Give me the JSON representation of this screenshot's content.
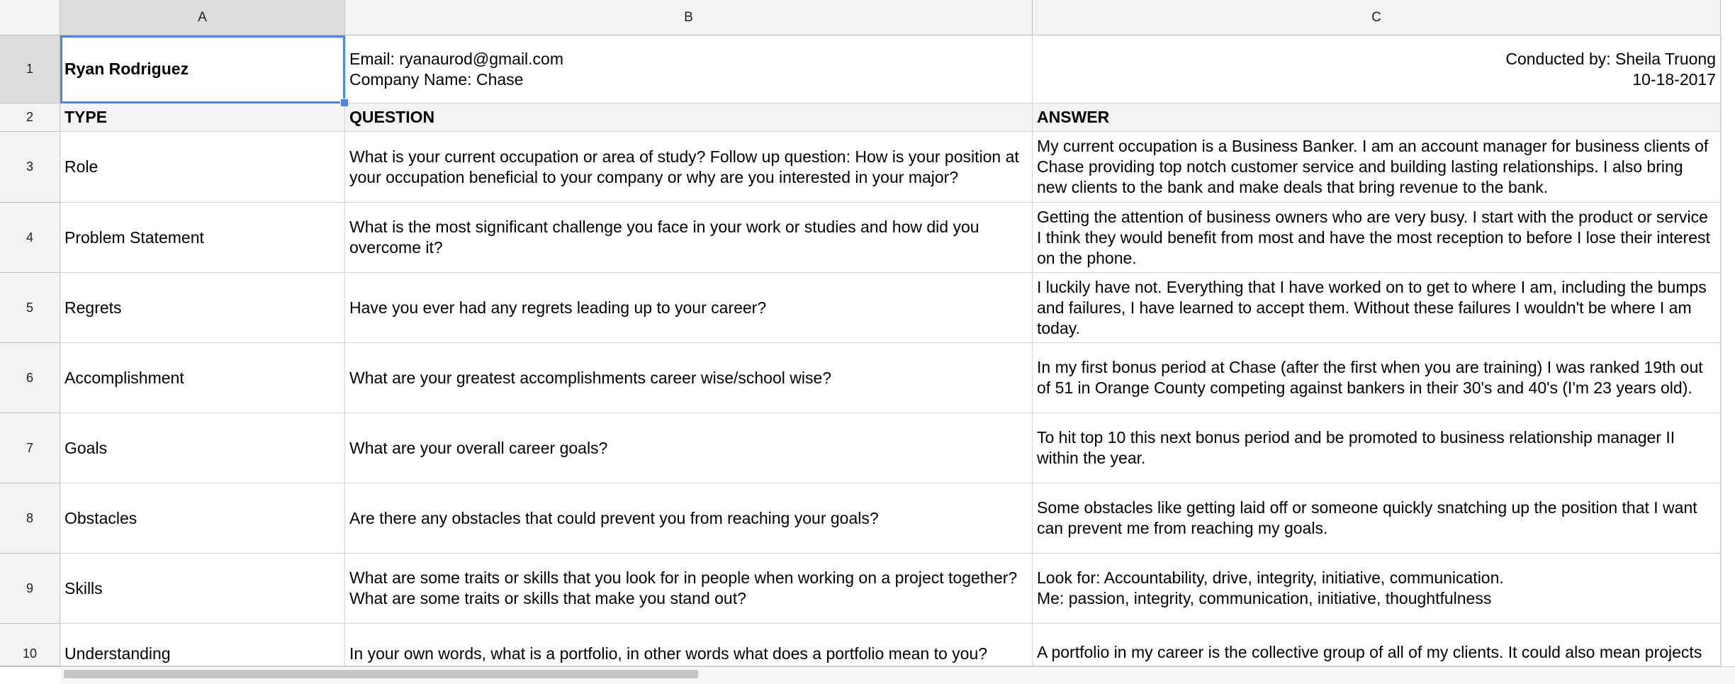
{
  "columns": [
    "A",
    "B",
    "C"
  ],
  "rows": [
    "1",
    "2",
    "3",
    "4",
    "5",
    "6",
    "7",
    "8",
    "9",
    "10"
  ],
  "header": {
    "name": "Ryan Rodriguez",
    "contact": "Email: ryanaurod@gmail.com\nCompany Name: Chase",
    "conducted": "Conducted by: Sheila Truong\n10-18-2017"
  },
  "labels": {
    "type": "TYPE",
    "question": "QUESTION",
    "answer": "ANSWER"
  },
  "entries": [
    {
      "type": "Role",
      "question": "What is your current occupation or area of study? Follow up question: How is your position at your occupation beneficial to your company or why are you interested in your major?",
      "answer": "My current occupation is a Business Banker. I am an account manager for business clients of Chase providing top notch customer service and building lasting relationships. I also bring new clients to the bank and make deals that bring revenue to the bank."
    },
    {
      "type": "Problem Statement",
      "question": "What is the most significant challenge you face in your work or studies and how did you overcome it?",
      "answer": "Getting the attention of business owners who are very busy. I start with the product or service I think they would benefit from most and have the most reception to before I lose their interest on the phone."
    },
    {
      "type": "Regrets",
      "question": "Have you ever had any regrets leading up to your career?",
      "answer": "I luckily have not. Everything that I have worked on to get to where I am, including the bumps and failures, I have learned to accept them. Without these failures I wouldn't be where I am today."
    },
    {
      "type": "Accomplishment",
      "question": "What are your greatest accomplishments career wise/school wise?",
      "answer": "In my first bonus period at Chase (after the first when you are training) I was ranked 19th out of 51 in Orange County competing against bankers in their 30's and 40's (I'm 23 years old)."
    },
    {
      "type": "Goals",
      "question": "What are your overall career goals?",
      "answer": "To hit top 10 this next bonus period and be promoted to business relationship manager II within the year."
    },
    {
      "type": "Obstacles",
      "question": "Are there any obstacles that could prevent you from reaching your goals?",
      "answer": "Some obstacles like getting laid off or someone quickly snatching up the position that I want can prevent me from reaching my goals."
    },
    {
      "type": "Skills",
      "question": "What are some traits or skills that you look for in people when working on a project together? What are some traits or skills that make you stand out?",
      "answer": "Look for: Accountability, drive, integrity, initiative, communication.\nMe: passion, integrity, communication, initiative, thoughtfulness"
    },
    {
      "type": "Understanding",
      "question": "In your own words, what is a portfolio, in other words what does a portfolio mean to you?",
      "answer": "A portfolio in my career is the collective group of all of my clients. It could also mean projects"
    }
  ]
}
